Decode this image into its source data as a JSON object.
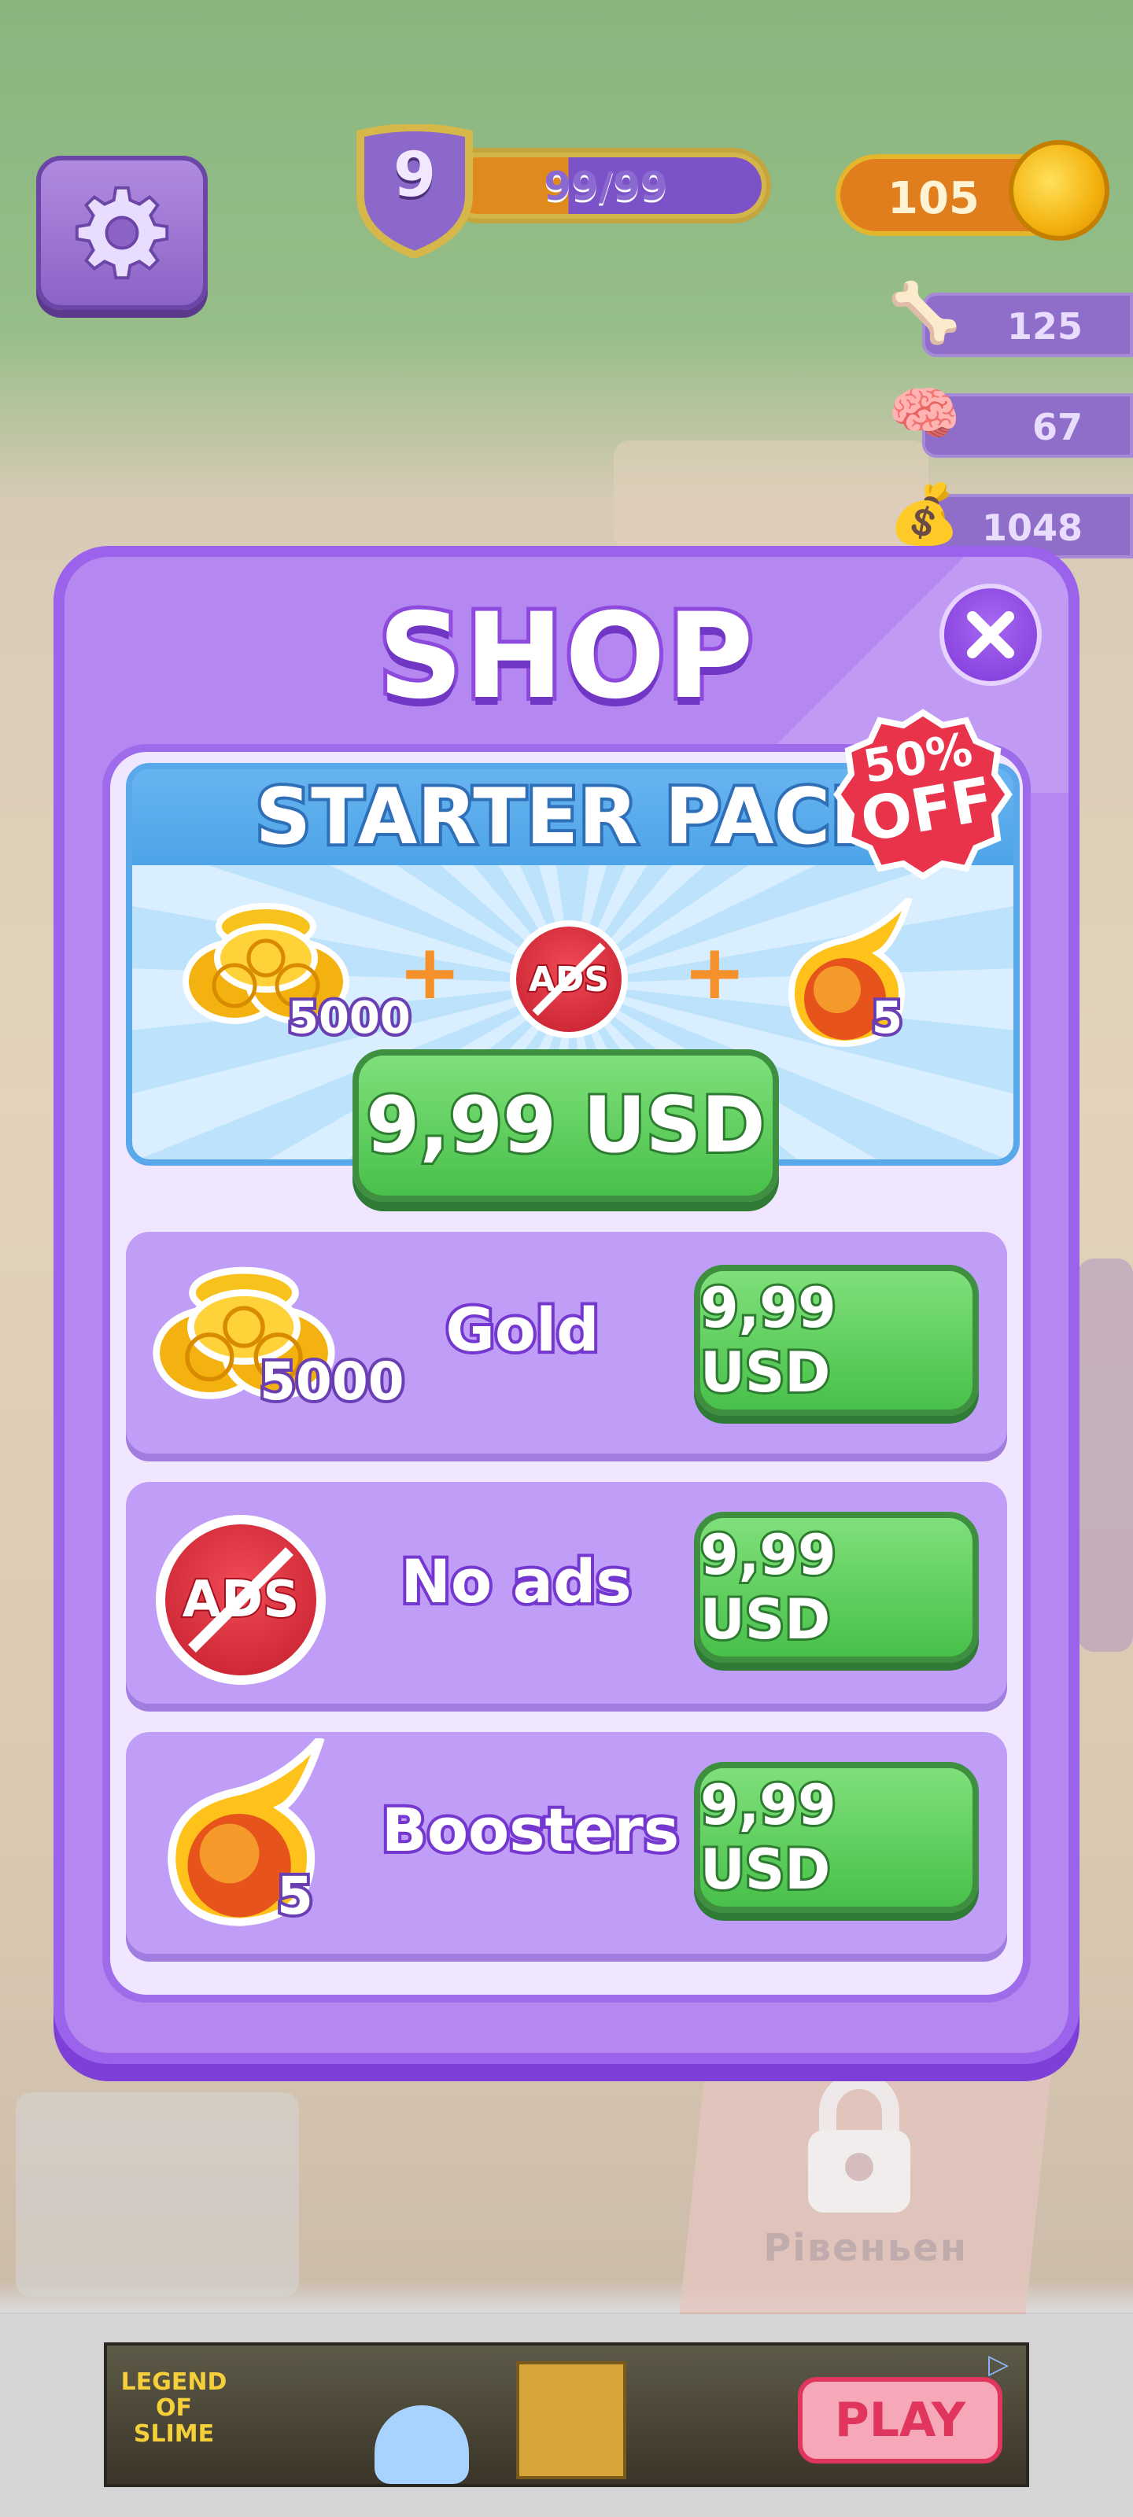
{
  "hud": {
    "level": "9",
    "xp_text": "99/99",
    "coins": "105",
    "resources": [
      {
        "name": "bone",
        "icon": "bone-icon",
        "value": "125"
      },
      {
        "name": "brain",
        "icon": "brain-icon",
        "value": "67"
      },
      {
        "name": "pouch",
        "icon": "pouch-icon",
        "value": "1048"
      }
    ]
  },
  "shop": {
    "title": "SHOP",
    "starter_pack": {
      "title": "STARTER PACK",
      "badge_percent": "50%",
      "badge_off": "OFF",
      "coins_qty": "5000",
      "ads_label": "ADS",
      "boosters_qty": "5",
      "price": "9,99 USD"
    },
    "items": [
      {
        "name": "Gold",
        "qty": "5000",
        "price": "9,99 USD",
        "icon": "gold-coins-icon"
      },
      {
        "name": "No ads",
        "qty": "",
        "price": "9,99 USD",
        "icon": "no-ads-icon"
      },
      {
        "name": "Boosters",
        "qty": "5",
        "price": "9,99 USD",
        "icon": "fireball-icon"
      }
    ],
    "ads_icon_label": "ADS"
  },
  "background": {
    "lock_label": "Рівеньен"
  },
  "ad": {
    "logo_text": "LEGEND OF SLIME",
    "play_label": "PLAY"
  },
  "colors": {
    "modal": "#b487f1",
    "button_green": "#48c04a",
    "accent_purple": "#7437cf",
    "badge_red": "#e8334b"
  }
}
